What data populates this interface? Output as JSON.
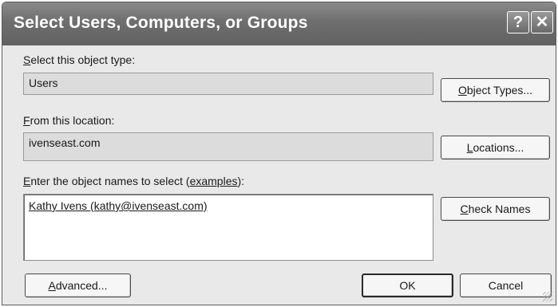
{
  "window": {
    "title": "Select Users, Computers, or Groups",
    "help_icon": "?",
    "close_icon": "✕"
  },
  "object_type": {
    "label_first": "S",
    "label_rest": "elect this object type:",
    "value": "Users",
    "button_first": "O",
    "button_rest": "bject Types..."
  },
  "location": {
    "label_first": "F",
    "label_rest": "rom this location:",
    "value": "ivenseast.com",
    "button_first": "L",
    "button_rest": "ocations..."
  },
  "names": {
    "label_first": "E",
    "label_mid": "nter the object names to select (",
    "label_link": "examples",
    "label_end": "):",
    "value": "Kathy Ivens (kathy@ivenseast.com)",
    "button_first": "C",
    "button_rest": "heck Names"
  },
  "footer": {
    "advanced_first": "A",
    "advanced_rest": "dvanced...",
    "ok_label": "OK",
    "cancel_label": "Cancel"
  },
  "colors": {
    "titlebar": "#6e6e6e",
    "dialog_bg": "#e9e9e9",
    "field_bg": "#dcdcdc"
  }
}
